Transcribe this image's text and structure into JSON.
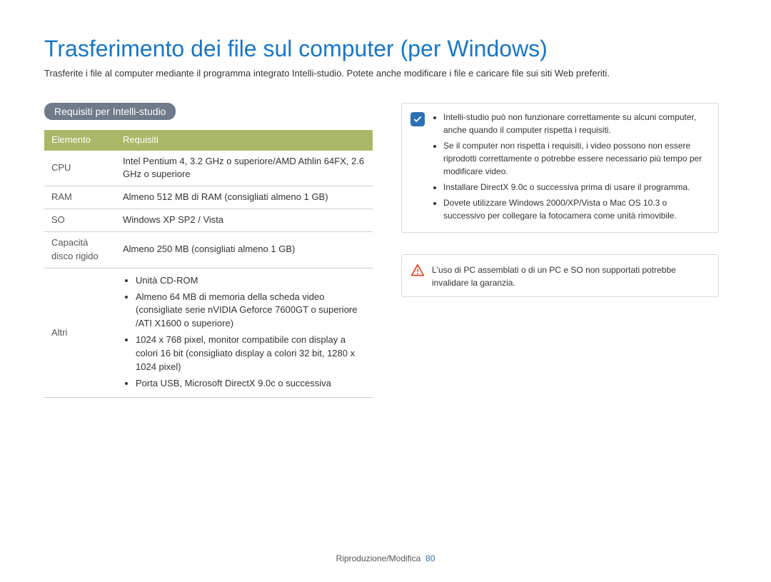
{
  "title": "Trasferimento dei file sul computer (per Windows)",
  "intro": "Trasferite i file al computer mediante il programma integrato Intelli-studio. Potete anche modificare i file e caricare file sui siti Web preferiti.",
  "badge": "Requisiti per Intelli-studio",
  "table": {
    "head1": "Elemento",
    "head2": "Requisiti",
    "rows": {
      "cpu_label": "CPU",
      "cpu_value": "Intel Pentium 4, 3.2 GHz o superiore/AMD Athlin 64FX, 2.6 GHz o superiore",
      "ram_label": "RAM",
      "ram_value": "Almeno 512 MB di RAM (consigliati almeno 1 GB)",
      "so_label": "SO",
      "so_value": "Windows XP SP2 / Vista",
      "hdd_label": "Capacità disco rigido",
      "hdd_value": "Almeno 250 MB (consigliati almeno 1 GB)",
      "other_label": "Altri",
      "other_items": {
        "i1": "Unità CD-ROM",
        "i2": "Almeno 64 MB di memoria della scheda video (consigliate serie nVIDIA Geforce 7600GT o superiore /ATI X1600 o superiore)",
        "i3": "1024 x 768 pixel, monitor compatibile con display a colori 16 bit (consigliato display a colori 32 bit, 1280 x 1024 pixel)",
        "i4": "Porta USB, Microsoft DirectX 9.0c o successiva"
      }
    }
  },
  "info_box": {
    "i1": "Intelli-studio può non funzionare correttamente su alcuni computer, anche quando il computer rispetta i requisiti.",
    "i2": "Se il computer non rispetta i requisiti, i video possono non essere riprodotti correttamente o potrebbe essere necessario più tempo per modificare video.",
    "i3": "Installare DirectX 9.0c o successiva prima di usare il programma.",
    "i4": "Dovete utilizzare Windows 2000/XP/Vista o Mac OS 10.3 o successivo per collegare la fotocamera come unità rimovibile."
  },
  "warn_box": "L'uso di PC assemblati o di un PC e SO non supportati potrebbe invalidare la garanzia.",
  "footer_section": "Riproduzione/Modifica",
  "footer_page": "80"
}
